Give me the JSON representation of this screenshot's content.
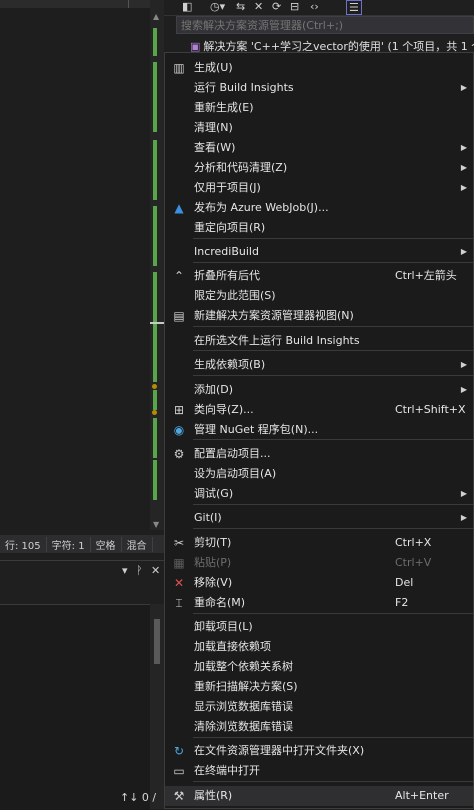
{
  "statusbar": {
    "line": "行: 105",
    "char": "字符: 1",
    "spaces": "空格",
    "mixed": "混合"
  },
  "search": {
    "placeholder": "搜索解决方案资源管理器(Ctrl+;)"
  },
  "tree": {
    "solution_label": "解决方案 'C++学习之vector的使用' (1 个项目，共 1 个"
  },
  "bottom": {
    "counter": "↑↓ 0 /"
  },
  "menu": {
    "items": [
      {
        "label": "生成(U)",
        "shortcut": "",
        "arrow": false,
        "icon": "build-icon"
      },
      {
        "label": "运行 Build Insights",
        "shortcut": "",
        "arrow": true,
        "icon": ""
      },
      {
        "label": "重新生成(E)",
        "shortcut": "",
        "arrow": false,
        "icon": ""
      },
      {
        "label": "清理(N)",
        "shortcut": "",
        "arrow": false,
        "icon": ""
      },
      {
        "label": "查看(W)",
        "shortcut": "",
        "arrow": true,
        "icon": ""
      },
      {
        "label": "分析和代码清理(Z)",
        "shortcut": "",
        "arrow": true,
        "icon": ""
      },
      {
        "label": "仅用于项目(J)",
        "shortcut": "",
        "arrow": true,
        "icon": ""
      },
      {
        "label": "发布为 Azure WebJob(J)...",
        "shortcut": "",
        "arrow": false,
        "icon": "azure-icon"
      },
      {
        "label": "重定向项目(R)",
        "shortcut": "",
        "arrow": false,
        "icon": ""
      },
      {
        "label": "IncrediBuild",
        "shortcut": "",
        "arrow": true,
        "icon": ""
      },
      {
        "label": "折叠所有后代",
        "shortcut": "Ctrl+左箭头",
        "arrow": false,
        "icon": "collapse-icon"
      },
      {
        "label": "限定为此范围(S)",
        "shortcut": "",
        "arrow": false,
        "icon": ""
      },
      {
        "label": "新建解决方案资源管理器视图(N)",
        "shortcut": "",
        "arrow": false,
        "icon": "new-view-icon"
      },
      {
        "label": "在所选文件上运行 Build Insights",
        "shortcut": "",
        "arrow": false,
        "icon": ""
      },
      {
        "label": "生成依赖项(B)",
        "shortcut": "",
        "arrow": true,
        "icon": ""
      },
      {
        "label": "添加(D)",
        "shortcut": "",
        "arrow": true,
        "icon": ""
      },
      {
        "label": "类向导(Z)...",
        "shortcut": "Ctrl+Shift+X",
        "arrow": false,
        "icon": "class-wizard-icon"
      },
      {
        "label": "管理 NuGet 程序包(N)...",
        "shortcut": "",
        "arrow": false,
        "icon": "nuget-icon"
      },
      {
        "label": "配置启动项目...",
        "shortcut": "",
        "arrow": false,
        "icon": "gear-icon"
      },
      {
        "label": "设为启动项目(A)",
        "shortcut": "",
        "arrow": false,
        "icon": ""
      },
      {
        "label": "调试(G)",
        "shortcut": "",
        "arrow": true,
        "icon": ""
      },
      {
        "label": "Git(I)",
        "shortcut": "",
        "arrow": true,
        "icon": ""
      },
      {
        "label": "剪切(T)",
        "shortcut": "Ctrl+X",
        "arrow": false,
        "icon": "scissors-icon"
      },
      {
        "label": "粘贴(P)",
        "shortcut": "Ctrl+V",
        "arrow": false,
        "icon": "paste-icon",
        "disabled": true
      },
      {
        "label": "移除(V)",
        "shortcut": "Del",
        "arrow": false,
        "icon": "remove-icon"
      },
      {
        "label": "重命名(M)",
        "shortcut": "F2",
        "arrow": false,
        "icon": "rename-icon"
      },
      {
        "label": "卸载项目(L)",
        "shortcut": "",
        "arrow": false,
        "icon": ""
      },
      {
        "label": "加载直接依赖项",
        "shortcut": "",
        "arrow": false,
        "icon": ""
      },
      {
        "label": "加载整个依赖关系树",
        "shortcut": "",
        "arrow": false,
        "icon": ""
      },
      {
        "label": "重新扫描解决方案(S)",
        "shortcut": "",
        "arrow": false,
        "icon": ""
      },
      {
        "label": "显示浏览数据库错误",
        "shortcut": "",
        "arrow": false,
        "icon": ""
      },
      {
        "label": "清除浏览数据库错误",
        "shortcut": "",
        "arrow": false,
        "icon": ""
      },
      {
        "label": "在文件资源管理器中打开文件夹(X)",
        "shortcut": "",
        "arrow": false,
        "icon": "open-folder-icon"
      },
      {
        "label": "在终端中打开",
        "shortcut": "",
        "arrow": false,
        "icon": "terminal-icon"
      },
      {
        "label": "属性(R)",
        "shortcut": "Alt+Enter",
        "arrow": false,
        "icon": "wrench-icon",
        "hover": true
      }
    ]
  },
  "colors": {
    "menu_bg": "#1b1b1c",
    "change_bar": "#57a64a",
    "hover": "#2f2f31"
  }
}
